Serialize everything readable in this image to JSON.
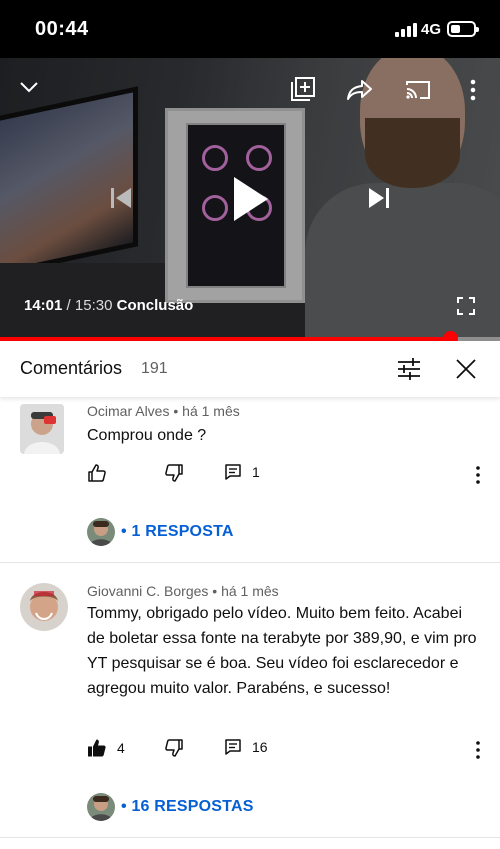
{
  "status": {
    "time": "00:44",
    "network": "4G"
  },
  "player": {
    "current_time": "14:01",
    "separator": " / ",
    "duration": "15:30",
    "chapter": "Conclusão",
    "progress_fraction": 0.9
  },
  "comments_header": {
    "title": "Comentários",
    "count": "191"
  },
  "comments": [
    {
      "author": "Ocimar Alves",
      "age": "há 1 mês",
      "text": "Comprou onde ?",
      "likes": "",
      "reply_count": "1",
      "replies_label": "• 1 RESPOSTA",
      "liked": false
    },
    {
      "author": "Giovanni C. Borges",
      "age": "há 1 mês",
      "text": "Tommy, obrigado pelo vídeo. Muito bem feito. Acabei de boletar essa fonte na terabyte por 389,90, e vim pro YT pesquisar se é boa. Seu vídeo foi esclarecedor e agregou muito valor. Parabéns, e sucesso!",
      "likes": "4",
      "reply_count": "16",
      "replies_label": "• 16 RESPOSTAS",
      "liked": true
    }
  ],
  "colors": {
    "accent": "#ff0000",
    "link": "#065fd4",
    "muted": "#606060"
  }
}
